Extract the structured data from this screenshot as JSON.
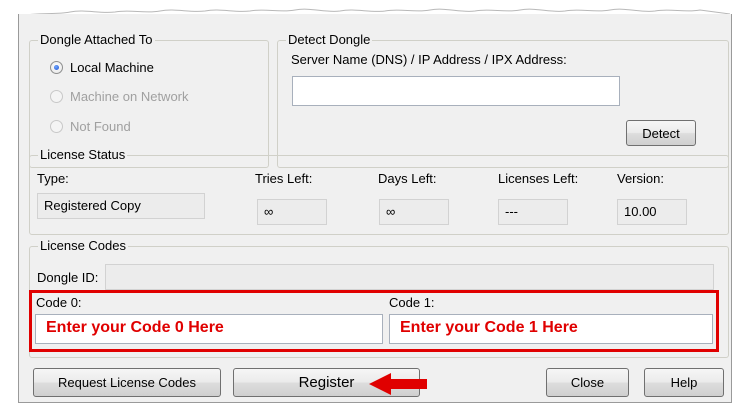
{
  "dongle_attached": {
    "title": "Dongle Attached To",
    "options": [
      {
        "label": "Local Machine",
        "selected": true,
        "enabled": true
      },
      {
        "label": "Machine on Network",
        "selected": false,
        "enabled": false
      },
      {
        "label": "Not Found",
        "selected": false,
        "enabled": false
      }
    ]
  },
  "detect_dongle": {
    "title": "Detect Dongle",
    "server_label": "Server Name (DNS) / IP Address / IPX Address:",
    "server_value": "",
    "detect_button": "Detect"
  },
  "license_status": {
    "title": "License Status",
    "type_label": "Type:",
    "type_value": "Registered Copy",
    "tries_label": "Tries Left:",
    "tries_value": "∞",
    "days_label": "Days Left:",
    "days_value": "∞",
    "licenses_label": "Licenses Left:",
    "licenses_value": "---",
    "version_label": "Version:",
    "version_value": "10.00"
  },
  "license_codes": {
    "title": "License Codes",
    "dongle_id_label": "Dongle ID:",
    "dongle_id_value": "",
    "code0_label": "Code 0:",
    "code0_value": "Enter your Code 0 Here",
    "code1_label": "Code 1:",
    "code1_value": "Enter your Code 1 Here"
  },
  "buttons": {
    "request": "Request License Codes",
    "register": "Register",
    "close": "Close",
    "help": "Help"
  },
  "annotation": {
    "highlight_color": "#e00000",
    "arrow_target": "Register"
  }
}
